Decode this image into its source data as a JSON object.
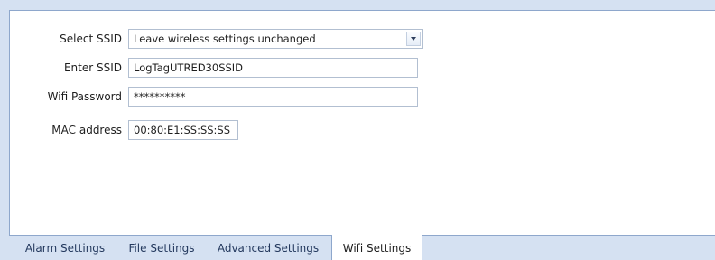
{
  "form": {
    "select_ssid": {
      "label": "Select SSID",
      "value": "Leave wireless settings unchanged"
    },
    "enter_ssid": {
      "label": "Enter SSID",
      "value": "LogTagUTRED30SSID"
    },
    "wifi_password": {
      "label": "Wifi Password",
      "value": "**********"
    },
    "mac_address": {
      "label": "MAC address",
      "value": "00:80:E1:SS:SS:SS"
    },
    "dropdown_icon": "chevron-down-icon"
  },
  "tabs": [
    {
      "label": "Alarm Settings",
      "active": false
    },
    {
      "label": "File Settings",
      "active": false
    },
    {
      "label": "Advanced Settings",
      "active": false
    },
    {
      "label": "Wifi Settings",
      "active": true
    }
  ],
  "colors": {
    "background": "#d5e1f2",
    "panel_border": "#8ea7cc",
    "tab_text": "#24395e"
  }
}
